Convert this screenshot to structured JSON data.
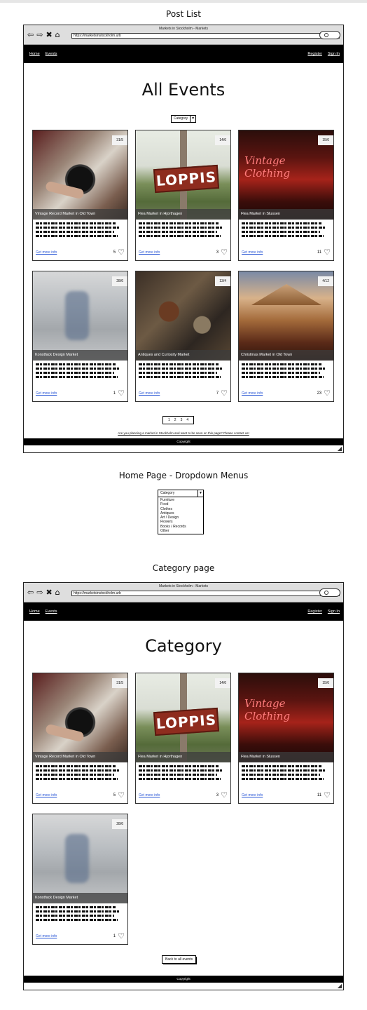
{
  "sections": {
    "post_list": "Post List",
    "dropdown": "Home Page - Dropdown Menus",
    "category_page": "Category page"
  },
  "browser": {
    "window_title": "Markets in Stockholm - Markets",
    "url": "https://marketsinstockholm.urb"
  },
  "nav": {
    "home": "Home",
    "events": "Events",
    "register": "Register",
    "sign_in": "Sign In"
  },
  "post_list": {
    "heading": "All Events",
    "category_select": "Category",
    "cards": [
      {
        "title": "Vintage Record Market in Old Town",
        "date": "31/5",
        "link": "Get more info",
        "likes": "5"
      },
      {
        "title": "Flea Market in Hjorthagen",
        "date": "14/6",
        "link": "Get more info",
        "likes": "3"
      },
      {
        "title": "Flea Market in Slussen",
        "date": "15/6",
        "link": "Get more info",
        "likes": "11"
      },
      {
        "title": "Konstfack Design Market",
        "date": "28/6",
        "link": "Get more info",
        "likes": "1"
      },
      {
        "title": "Antiques and Curiosity Market",
        "date": "13/4",
        "link": "Get more info",
        "likes": "7"
      },
      {
        "title": "Christmas Market in Old Town",
        "date": "4/12",
        "link": "Get more info",
        "likes": "23"
      }
    ],
    "pages": [
      "1",
      "2",
      "3",
      "4"
    ],
    "contact": "Are you planning a market in Stockholm and want to be seen on this page? Please contact us!",
    "copyright": "Copyright"
  },
  "dropdown": {
    "label": "Category",
    "options": [
      "Furniture",
      "Food",
      "Clothes",
      "Antiques",
      "Art / Design",
      "Flowers",
      "Books / Records",
      "Other"
    ]
  },
  "category_page": {
    "heading": "Category",
    "cards": [
      {
        "title": "Vintage Record Market in Old Town",
        "date": "31/5",
        "link": "Get more info",
        "likes": "5"
      },
      {
        "title": "Flea Market in Hjorthagen",
        "date": "14/6",
        "link": "Get more info",
        "likes": "3"
      },
      {
        "title": "Flea Market in Slussen",
        "date": "15/6",
        "link": "Get more info",
        "likes": "11"
      },
      {
        "title": "Konstfack Design Market",
        "date": "28/6",
        "link": "Get more info",
        "likes": "1"
      }
    ],
    "back_button": "Back to all events",
    "copyright": "Copyright"
  },
  "images": {
    "loppis_sign": "LOPPIS",
    "vintage_sign": "Vintage Clothing"
  },
  "icons": {
    "back": "back-arrow-icon",
    "forward": "forward-arrow-icon",
    "stop": "close-icon",
    "home": "home-icon",
    "heart": "heart-icon",
    "dropdown": "chevron-down-icon"
  }
}
